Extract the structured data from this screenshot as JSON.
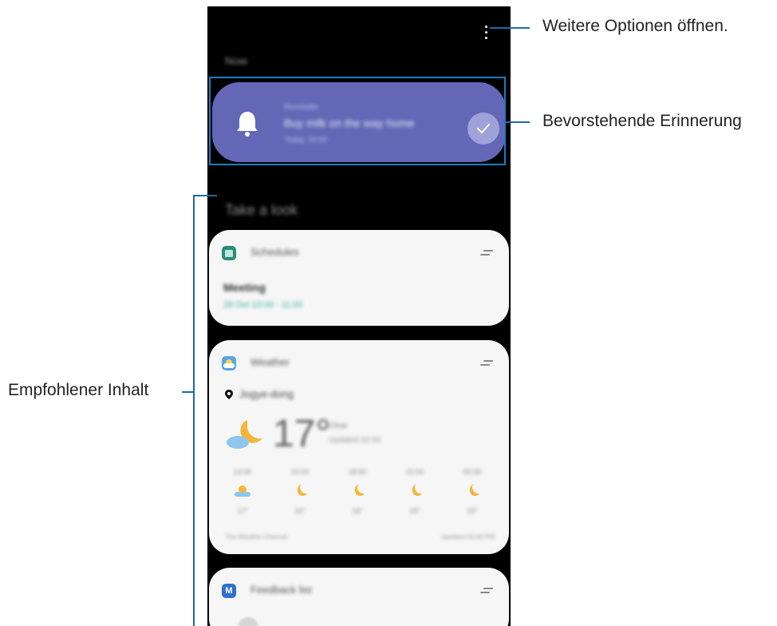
{
  "annotations": {
    "more_options": "Weitere Optionen öffnen.",
    "upcoming_reminder": "Bevorstehende Erinnerung",
    "recommended_content": "Empfohlener Inhalt"
  },
  "screen": {
    "now_label": "Now",
    "reminder": {
      "category": "Reminder",
      "text": "Buy milk on the way home",
      "time": "Today 18:00",
      "color": "#6367b6"
    },
    "take_a_look_label": "Take a look",
    "schedule_card": {
      "title": "Schedules",
      "event": "Meeting",
      "time": "28 Oct 10:00 - 11:00",
      "icon": "calendar-icon",
      "accent": "#2a9d8f"
    },
    "weather_card": {
      "title": "Weather",
      "location": "Jogye-dong",
      "temperature": "17°",
      "condition": "Clear",
      "details": "Updated 02:00",
      "icon": "weather-icon",
      "hourly": [
        {
          "time": "13:00",
          "temp": "17°",
          "icon": "sun-cloud-icon"
        },
        {
          "time": "15:00",
          "temp": "16°",
          "icon": "moon-icon"
        },
        {
          "time": "18:00",
          "temp": "16°",
          "icon": "moon-icon"
        },
        {
          "time": "21:00",
          "temp": "15°",
          "icon": "moon-icon"
        },
        {
          "time": "00:00",
          "temp": "15°",
          "icon": "moon-icon"
        }
      ],
      "footer_left": "The Weather Channel",
      "footer_right": "Updated 02:00 PM"
    },
    "feedback_card": {
      "title": "Feedback list",
      "icon": "members-icon"
    }
  }
}
